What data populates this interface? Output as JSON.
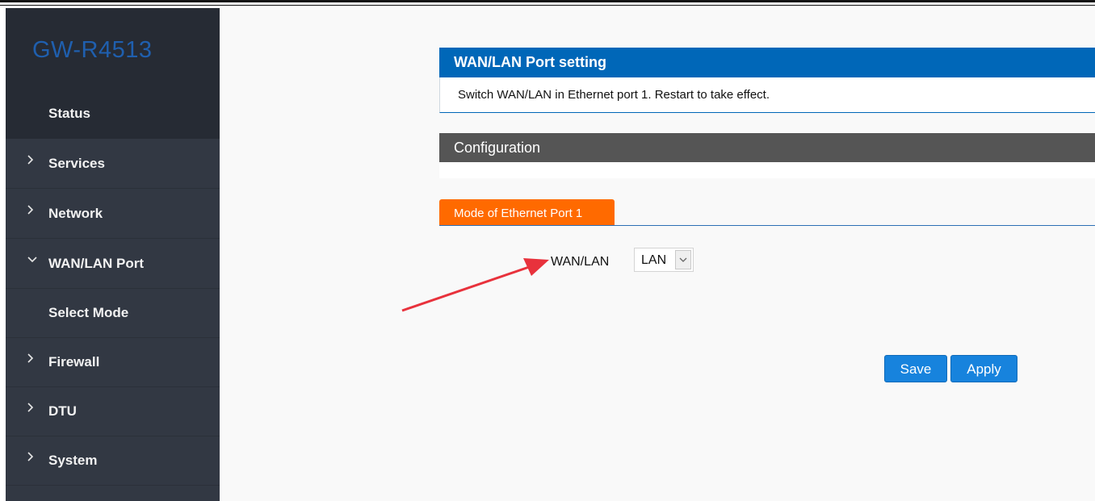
{
  "sidebar": {
    "brand": "GW-R4513",
    "status_label": "Status",
    "items": [
      {
        "label": "Services",
        "expanded": false
      },
      {
        "label": "Network",
        "expanded": false
      },
      {
        "label": "WAN/LAN Port",
        "expanded": true
      },
      {
        "label": "Select Mode",
        "sub": true
      },
      {
        "label": "Firewall",
        "expanded": false
      },
      {
        "label": "DTU",
        "expanded": false
      },
      {
        "label": "System",
        "expanded": false
      }
    ]
  },
  "main": {
    "section_title": "WAN/LAN Port setting",
    "section_desc": "Switch WAN/LAN in Ethernet port 1. Restart to take effect.",
    "config_title": "Configuration",
    "tab_label": "Mode of Ethernet Port 1",
    "field_label": "WAN/LAN",
    "field_value": "LAN",
    "save_label": "Save",
    "apply_label": "Apply"
  },
  "colors": {
    "sidebar_bg": "#323843",
    "brand_bg": "#262b34",
    "brand_text": "#1f5fae",
    "header_blue": "#0067b8",
    "config_gray": "#555555",
    "tab_orange": "#ff6a00",
    "button_blue": "#1783dd",
    "annotation_arrow": "#e8323c"
  },
  "icons": {
    "collapsed": "chevron-right-icon",
    "expanded": "chevron-down-icon",
    "dropdown": "chevron-down-icon"
  }
}
